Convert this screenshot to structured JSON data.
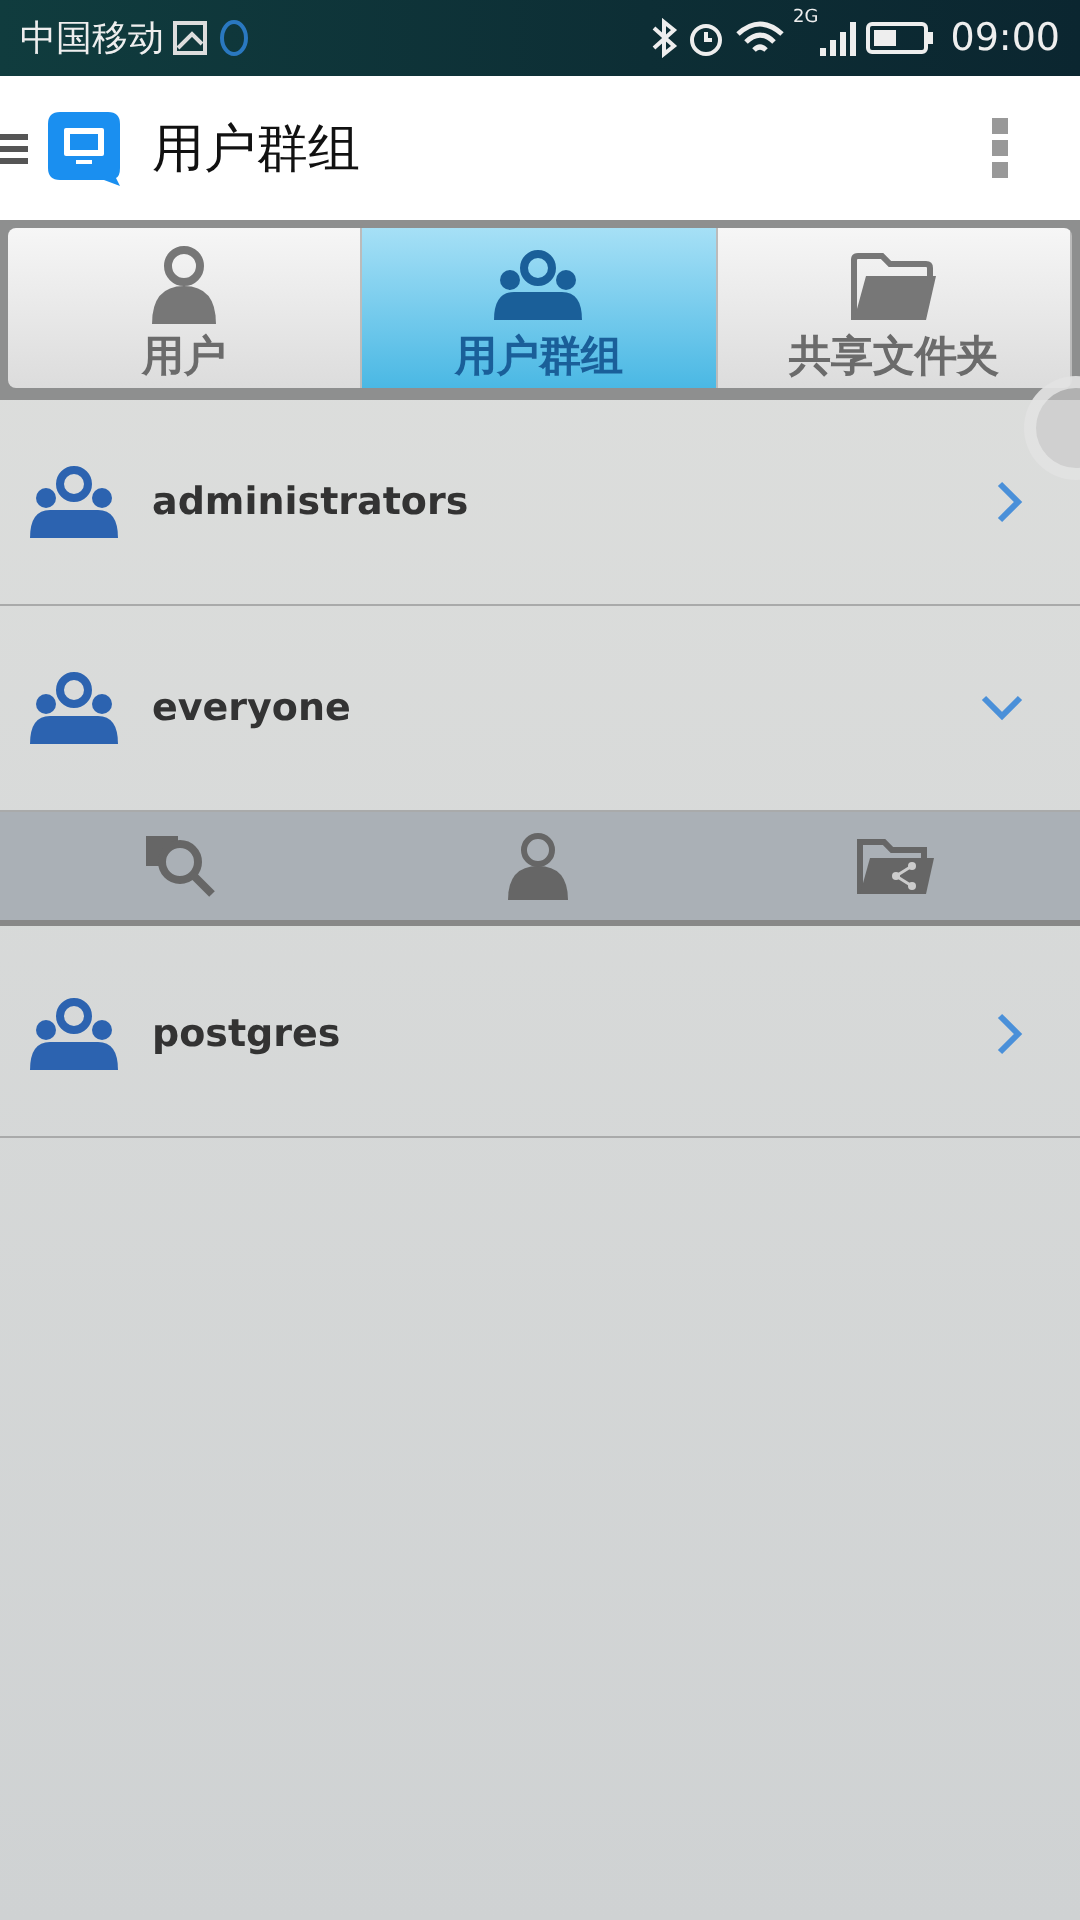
{
  "status_bar": {
    "carrier": "中国移动",
    "network": "2G",
    "time": "09:00"
  },
  "app_bar": {
    "title": "用户群组"
  },
  "tabs": [
    {
      "label": "用户",
      "kind": "user",
      "selected": false
    },
    {
      "label": "用户群组",
      "kind": "group",
      "selected": true
    },
    {
      "label": "共享文件夹",
      "kind": "folder",
      "selected": false
    }
  ],
  "groups": [
    {
      "name": "administrators",
      "expanded": false
    },
    {
      "name": "everyone",
      "expanded": true
    },
    {
      "name": "postgres",
      "expanded": false
    }
  ]
}
